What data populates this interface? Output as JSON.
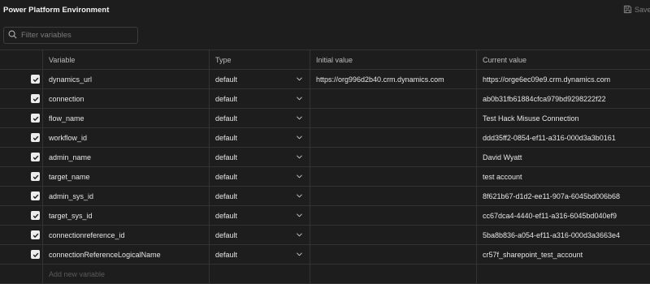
{
  "header": {
    "title": "Power Platform Environment",
    "save_label": "Save",
    "save_icon": "save-icon"
  },
  "filter": {
    "placeholder": "Filter variables",
    "value": "",
    "icon": "search-icon"
  },
  "table": {
    "columns": {
      "variable": "Variable",
      "type": "Type",
      "initial": "Initial value",
      "current": "Current value"
    },
    "rows": [
      {
        "checked": true,
        "variable": "dynamics_url",
        "type": "default",
        "initial": "https://org996d2b40.crm.dynamics.com",
        "current": "https://orge6ec09e9.crm.dynamics.com"
      },
      {
        "checked": true,
        "variable": "connection",
        "type": "default",
        "initial": "",
        "current": "ab0b31fb61884cfca979bd9298222f22"
      },
      {
        "checked": true,
        "variable": "flow_name",
        "type": "default",
        "initial": "",
        "current": "Test Hack Misuse Connection"
      },
      {
        "checked": true,
        "variable": "workflow_id",
        "type": "default",
        "initial": "",
        "current": "ddd35ff2-0854-ef11-a316-000d3a3b0161"
      },
      {
        "checked": true,
        "variable": "admin_name",
        "type": "default",
        "initial": "",
        "current": "David Wyatt"
      },
      {
        "checked": true,
        "variable": "target_name",
        "type": "default",
        "initial": "",
        "current": "test account"
      },
      {
        "checked": true,
        "variable": "admin_sys_id",
        "type": "default",
        "initial": "",
        "current": "8f621b67-d1d2-ee11-907a-6045bd006b68"
      },
      {
        "checked": true,
        "variable": "target_sys_id",
        "type": "default",
        "initial": "",
        "current": "cc67dca4-4440-ef11-a316-6045bd040ef9"
      },
      {
        "checked": true,
        "variable": "connectionreference_id",
        "type": "default",
        "initial": "",
        "current": "5ba8b836-a054-ef11-a316-000d3a3663e4"
      },
      {
        "checked": true,
        "variable": "connectionReferenceLogicalName",
        "type": "default",
        "initial": "",
        "current": "cr57f_sharepoint_test_account"
      }
    ],
    "add_placeholder": "Add new variable"
  },
  "colors": {
    "background": "#1d1d1d",
    "border": "#333333",
    "text": "#e6e6e6",
    "checkbox": "#ececec"
  }
}
